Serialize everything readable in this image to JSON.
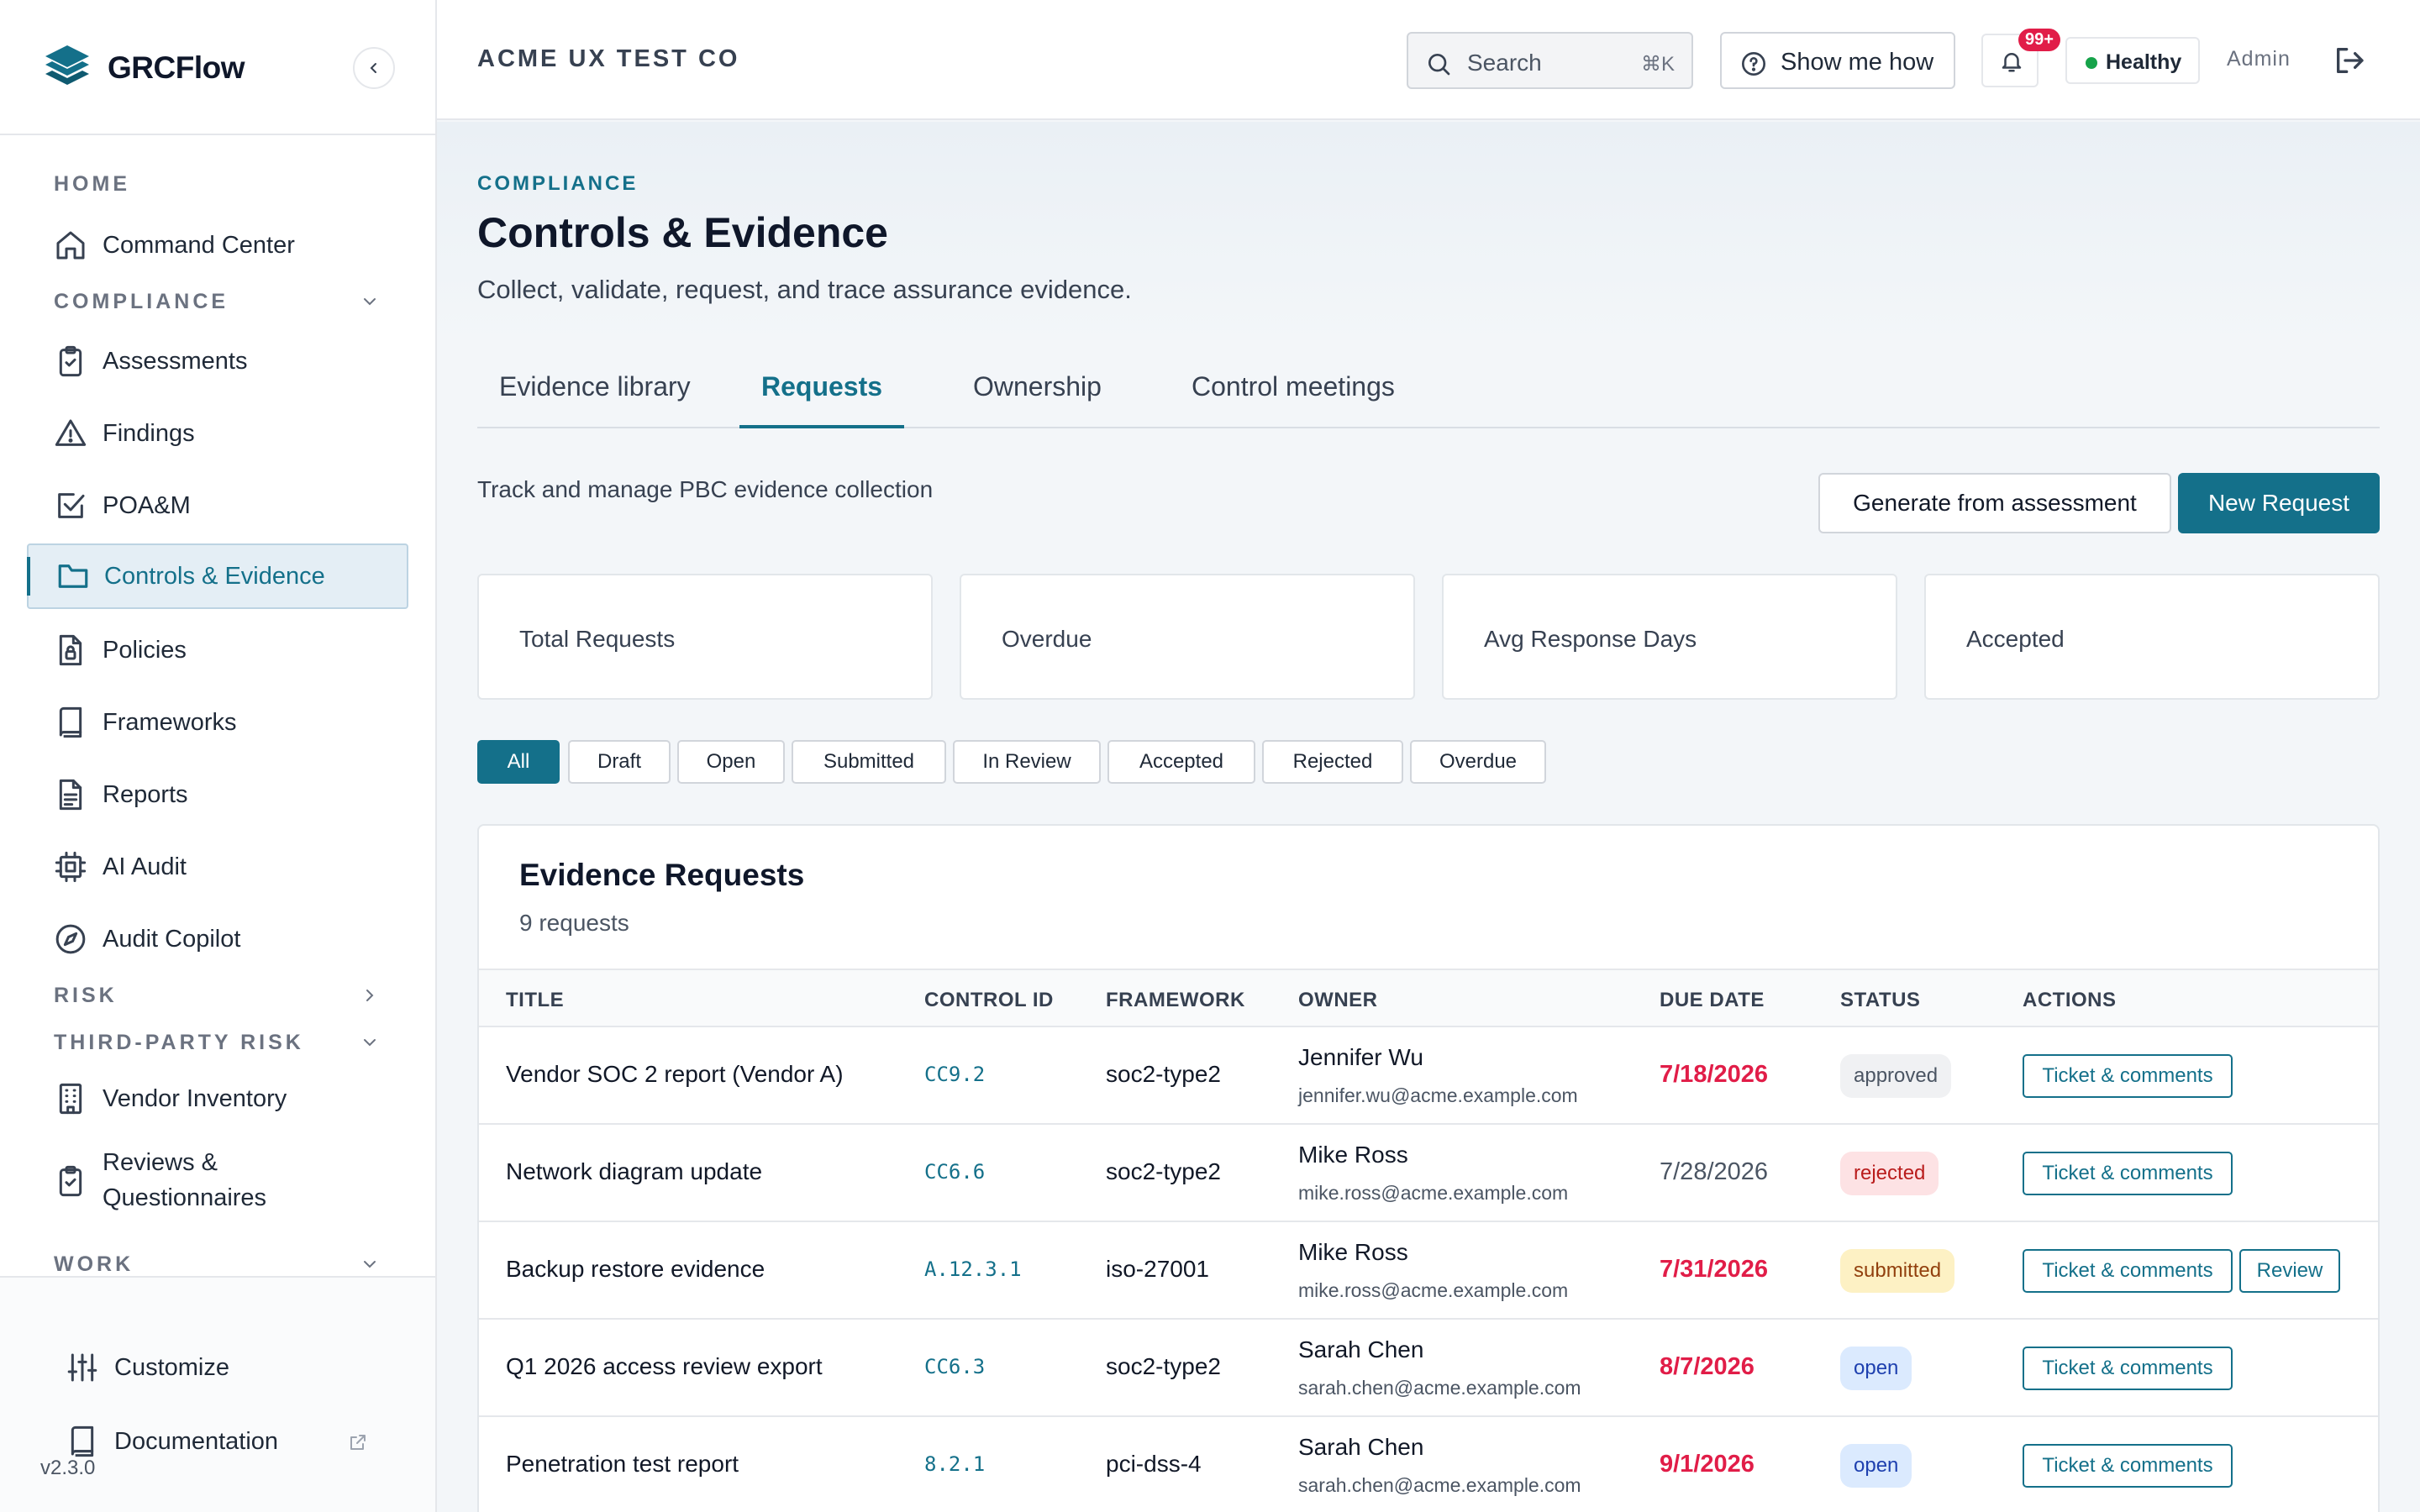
{
  "brand": {
    "name": "GRCFlow"
  },
  "nav": {
    "home_section": "HOME",
    "compliance_section": "COMPLIANCE",
    "risk_section": "RISK",
    "third_party_section": "THIRD-PARTY RISK",
    "work_section": "WORK",
    "items": {
      "command_center": "Command Center",
      "assessments": "Assessments",
      "findings": "Findings",
      "poam": "POA&M",
      "controls_evidence": "Controls & Evidence",
      "policies": "Policies",
      "frameworks": "Frameworks",
      "reports": "Reports",
      "ai_audit": "AI Audit",
      "audit_copilot": "Audit Copilot",
      "vendor_inventory": "Vendor Inventory",
      "reviews_line1": "Reviews &",
      "reviews_line2": "Questionnaires"
    }
  },
  "footer": {
    "customize": "Customize",
    "documentation": "Documentation",
    "version": "v2.3.0"
  },
  "header": {
    "org": "ACME UX TEST CO",
    "search_placeholder": "Search",
    "search_shortcut": "⌘K",
    "show_me_how": "Show me how",
    "notifications_badge": "99+",
    "health": "Healthy",
    "role": "Admin"
  },
  "page": {
    "eyebrow": "COMPLIANCE",
    "title": "Controls & Evidence",
    "subtitle": "Collect, validate, request, and trace assurance evidence.",
    "tabs": [
      "Evidence library",
      "Requests",
      "Ownership",
      "Control meetings"
    ],
    "active_tab": "Requests",
    "section_desc": "Track and manage PBC evidence collection",
    "generate_button": "Generate from assessment",
    "new_request_button": "New Request",
    "stats": [
      "Total Requests",
      "Overdue",
      "Avg Response Days",
      "Accepted"
    ],
    "filters": [
      "All",
      "Draft",
      "Open",
      "Submitted",
      "In Review",
      "Accepted",
      "Rejected",
      "Overdue"
    ],
    "active_filter": "All"
  },
  "table": {
    "title": "Evidence Requests",
    "count": "9 requests",
    "columns": [
      "TITLE",
      "CONTROL ID",
      "FRAMEWORK",
      "OWNER",
      "DUE DATE",
      "STATUS",
      "ACTIONS"
    ],
    "action_ticket": "Ticket & comments",
    "action_review": "Review",
    "rows": [
      {
        "title": "Vendor SOC 2 report (Vendor A)",
        "control": "CC9.2",
        "framework": "soc2-type2",
        "owner": "Jennifer Wu",
        "email": "jennifer.wu@acme.example.com",
        "due": "7/18/2026",
        "overdue": true,
        "status": "approved"
      },
      {
        "title": "Network diagram update",
        "control": "CC6.6",
        "framework": "soc2-type2",
        "owner": "Mike Ross",
        "email": "mike.ross@acme.example.com",
        "due": "7/28/2026",
        "overdue": false,
        "status": "rejected"
      },
      {
        "title": "Backup restore evidence",
        "control": "A.12.3.1",
        "framework": "iso-27001",
        "owner": "Mike Ross",
        "email": "mike.ross@acme.example.com",
        "due": "7/31/2026",
        "overdue": true,
        "status": "submitted"
      },
      {
        "title": "Q1 2026 access review export",
        "control": "CC6.3",
        "framework": "soc2-type2",
        "owner": "Sarah Chen",
        "email": "sarah.chen@acme.example.com",
        "due": "8/7/2026",
        "overdue": true,
        "status": "open"
      },
      {
        "title": "Penetration test report",
        "control": "8.2.1",
        "framework": "pci-dss-4",
        "owner": "Sarah Chen",
        "email": "sarah.chen@acme.example.com",
        "due": "9/1/2026",
        "overdue": true,
        "status": "open"
      }
    ]
  },
  "colors": {
    "accent": "#14708a",
    "overdue": "#e11d48",
    "healthy": "#16a34a"
  }
}
